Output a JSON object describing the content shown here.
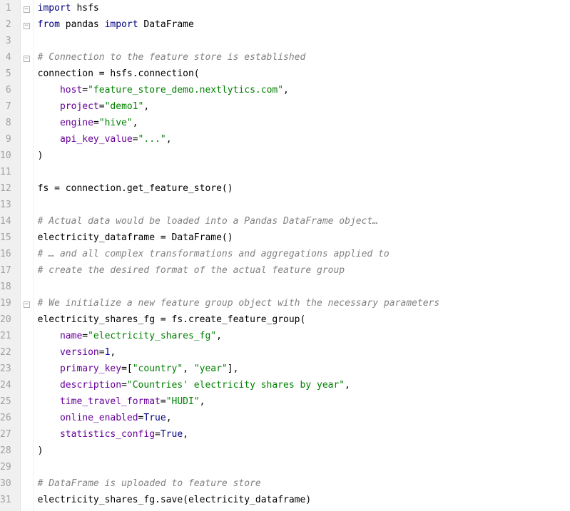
{
  "line_count": 31,
  "fold_markers": {
    "1": "minus",
    "2": "minus",
    "4": "minus",
    "19": "minus"
  },
  "tokens": {
    "l1": [
      [
        "kw",
        "import"
      ],
      [
        "id",
        " hsfs"
      ]
    ],
    "l2": [
      [
        "kw",
        "from"
      ],
      [
        "id",
        " pandas "
      ],
      [
        "kw",
        "import"
      ],
      [
        "id",
        " DataFrame"
      ]
    ],
    "l3": [],
    "l4": [
      [
        "cm",
        "# Connection to the feature store is established"
      ]
    ],
    "l5": [
      [
        "id",
        "connection = hsfs.connection("
      ]
    ],
    "l6": [
      [
        "id",
        "    "
      ],
      [
        "pa",
        "host"
      ],
      [
        "id",
        "="
      ],
      [
        "st",
        "\"feature_store_demo.nextlytics.com\""
      ],
      [
        "id",
        ","
      ]
    ],
    "l7": [
      [
        "id",
        "    "
      ],
      [
        "pa",
        "project"
      ],
      [
        "id",
        "="
      ],
      [
        "st",
        "\"demo1\""
      ],
      [
        "id",
        ","
      ]
    ],
    "l8": [
      [
        "id",
        "    "
      ],
      [
        "pa",
        "engine"
      ],
      [
        "id",
        "="
      ],
      [
        "st",
        "\"hive\""
      ],
      [
        "id",
        ","
      ]
    ],
    "l9": [
      [
        "id",
        "    "
      ],
      [
        "pa",
        "api_key_value"
      ],
      [
        "id",
        "="
      ],
      [
        "st",
        "\"...\""
      ],
      [
        "id",
        ","
      ]
    ],
    "l10": [
      [
        "id",
        ")"
      ]
    ],
    "l11": [],
    "l12": [
      [
        "id",
        "fs = connection.get_feature_store()"
      ]
    ],
    "l13": [],
    "l14": [
      [
        "cm",
        "# Actual data would be loaded into a Pandas DataFrame object…"
      ]
    ],
    "l15": [
      [
        "id",
        "electricity_dataframe = DataFrame()"
      ]
    ],
    "l16": [
      [
        "cm",
        "# … and all complex transformations and aggregations applied to"
      ]
    ],
    "l17": [
      [
        "cm",
        "# create the desired format of the actual feature group"
      ]
    ],
    "l18": [],
    "l19": [
      [
        "cm",
        "# We initialize a new feature group object with the necessary parameters"
      ]
    ],
    "l20": [
      [
        "id",
        "electricity_shares_fg = fs.create_feature_group("
      ]
    ],
    "l21": [
      [
        "id",
        "    "
      ],
      [
        "pa",
        "name"
      ],
      [
        "id",
        "="
      ],
      [
        "st",
        "\"electricity_shares_fg\""
      ],
      [
        "id",
        ","
      ]
    ],
    "l22": [
      [
        "id",
        "    "
      ],
      [
        "pa",
        "version"
      ],
      [
        "id",
        "="
      ],
      [
        "nm",
        "1"
      ],
      [
        "id",
        ","
      ]
    ],
    "l23": [
      [
        "id",
        "    "
      ],
      [
        "pa",
        "primary_key"
      ],
      [
        "id",
        "=["
      ],
      [
        "st",
        "\"country\""
      ],
      [
        "id",
        ", "
      ],
      [
        "st",
        "\"year\""
      ],
      [
        "id",
        "],"
      ]
    ],
    "l24": [
      [
        "id",
        "    "
      ],
      [
        "pa",
        "description"
      ],
      [
        "id",
        "="
      ],
      [
        "st",
        "\"Countries' electricity shares by year\""
      ],
      [
        "id",
        ","
      ]
    ],
    "l25": [
      [
        "id",
        "    "
      ],
      [
        "pa",
        "time_travel_format"
      ],
      [
        "id",
        "="
      ],
      [
        "st",
        "\"HUDI\""
      ],
      [
        "id",
        ","
      ]
    ],
    "l26": [
      [
        "id",
        "    "
      ],
      [
        "pa",
        "online_enabled"
      ],
      [
        "id",
        "="
      ],
      [
        "bl",
        "True"
      ],
      [
        "id",
        ","
      ]
    ],
    "l27": [
      [
        "id",
        "    "
      ],
      [
        "pa",
        "statistics_config"
      ],
      [
        "id",
        "="
      ],
      [
        "bl",
        "True"
      ],
      [
        "id",
        ","
      ]
    ],
    "l28": [
      [
        "id",
        ")"
      ]
    ],
    "l29": [],
    "l30": [
      [
        "cm",
        "# DataFrame is uploaded to feature store"
      ]
    ],
    "l31": [
      [
        "id",
        "electricity_shares_fg.save(electricity_dataframe)"
      ]
    ]
  }
}
